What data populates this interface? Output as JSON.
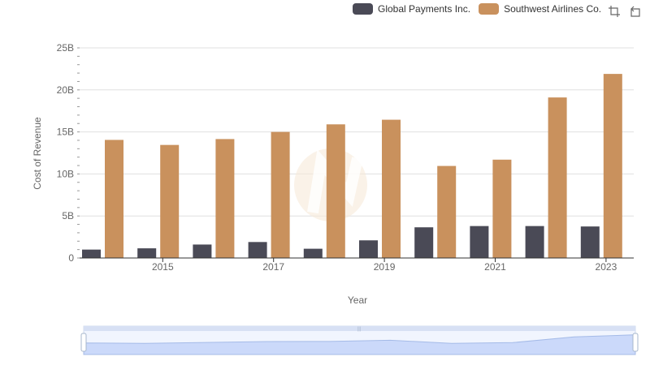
{
  "legend": [
    {
      "name": "Global Payments Inc.",
      "color": "#4a4a56"
    },
    {
      "name": "Southwest Airlines Co.",
      "color": "#c9915d"
    }
  ],
  "toolbox": {
    "zoom_icon": "data-zoom-icon",
    "reset_icon": "zoom-reset-icon"
  },
  "chart_data": {
    "type": "bar",
    "title": "",
    "xlabel": "Year",
    "ylabel": "Cost of Revenue",
    "x": [
      2014,
      2015,
      2016,
      2017,
      2018,
      2019,
      2020,
      2021,
      2022,
      2023
    ],
    "x_tick_labels": [
      "2015",
      "2017",
      "2019",
      "2021",
      "2023"
    ],
    "y_tick_labels": [
      "0",
      "5B",
      "10B",
      "15B",
      "20B",
      "25B"
    ],
    "ylim": [
      0,
      25000000000
    ],
    "grid": true,
    "legend_position": "top-right",
    "series": [
      {
        "name": "Global Payments Inc.",
        "color": "#4a4a56",
        "values": [
          1000000000,
          1150000000,
          1600000000,
          1900000000,
          1100000000,
          2100000000,
          3650000000,
          3800000000,
          3800000000,
          3750000000
        ]
      },
      {
        "name": "Southwest Airlines Co.",
        "color": "#c9915d",
        "values": [
          14050000000,
          13450000000,
          14150000000,
          15000000000,
          15900000000,
          16450000000,
          10950000000,
          11700000000,
          19100000000,
          21900000000
        ]
      }
    ]
  }
}
